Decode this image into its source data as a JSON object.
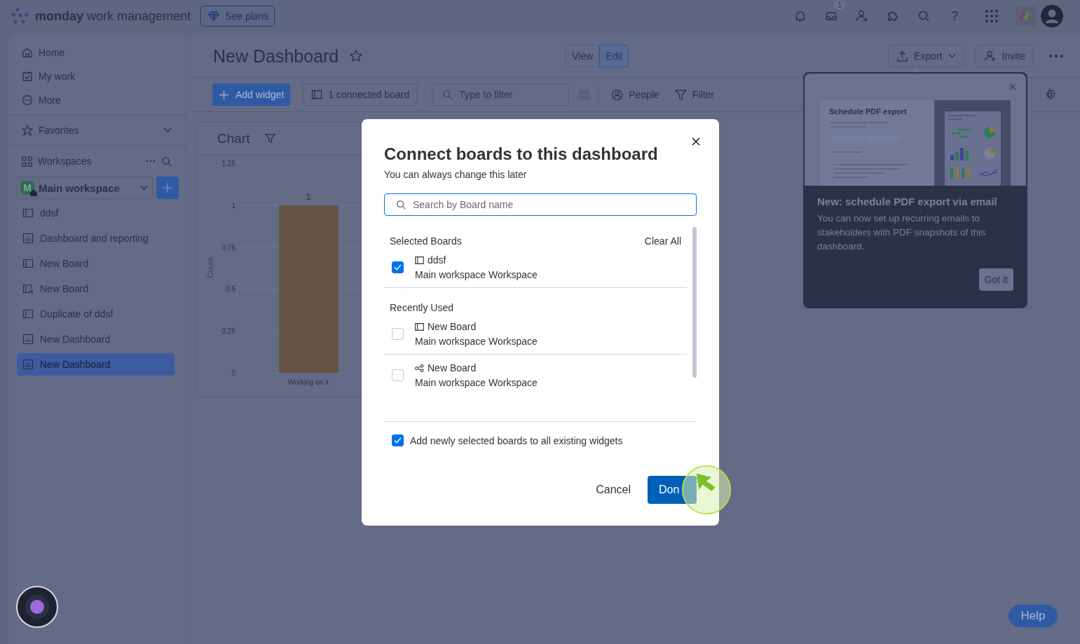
{
  "topbar": {
    "logo_bold": "monday",
    "logo_light": "work management",
    "plans_button": "See plans",
    "inbox_badge": "1",
    "help_glyph": "?"
  },
  "sidebar": {
    "nav": [
      {
        "label": "Home"
      },
      {
        "label": "My work"
      },
      {
        "label": "More"
      }
    ],
    "favorites": "Favorites",
    "workspaces": "Workspaces",
    "workspace": {
      "initial": "M",
      "name": "Main workspace"
    },
    "items": [
      {
        "label": "ddsf",
        "kind": "board",
        "selected": false
      },
      {
        "label": "Dashboard and reporting",
        "kind": "dashboard",
        "selected": false
      },
      {
        "label": "New Board",
        "kind": "board",
        "selected": false
      },
      {
        "label": "New Board",
        "kind": "shared",
        "selected": false
      },
      {
        "label": "Duplicate of ddsf",
        "kind": "board",
        "selected": false
      },
      {
        "label": "New Dashboard",
        "kind": "dashboard",
        "selected": false
      },
      {
        "label": "New Dashboard",
        "kind": "dashboard",
        "selected": true
      }
    ]
  },
  "dashboard": {
    "title": "New Dashboard",
    "view_toggle": [
      {
        "label": "View",
        "selected": false
      },
      {
        "label": "Edit",
        "selected": true
      }
    ],
    "export": "Export",
    "invite": "Invite",
    "toolbar": {
      "add_widget": "Add widget",
      "connected": "1 connected board",
      "filter_placeholder": "Type to filter",
      "people": "People",
      "filter": "Filter"
    }
  },
  "chart_widget": {
    "title": "Chart",
    "chart_data": {
      "type": "bar",
      "ylabel": "Count",
      "categories": [
        "Working on it"
      ],
      "values": [
        1
      ],
      "ylim": [
        0,
        1.25
      ],
      "yticks": [
        0,
        0.25,
        0.5,
        0.75,
        1,
        1.25
      ],
      "grid": true,
      "data_labels": true
    }
  },
  "popover": {
    "preview_title": "Schedule PDF export",
    "title": "New: schedule PDF export via email",
    "body": "You can now set up recurring emails to stakeholders with PDF snapshots of this dashboard.",
    "button": "Got it"
  },
  "modal": {
    "title": "Connect boards to this dashboard",
    "subtitle": "You can always change this later",
    "search": {
      "placeholder": "Search by Board name"
    },
    "sections": [
      {
        "title": "Selected Boards",
        "action": "Clear All",
        "boards": [
          {
            "name": "ddsf",
            "workspace": "Main workspace Workspace",
            "kind": "board",
            "checked": true
          }
        ]
      },
      {
        "title": "Recently Used",
        "boards": [
          {
            "name": "New Board",
            "workspace": "Main workspace Workspace",
            "kind": "board",
            "checked": false
          },
          {
            "name": "New Board",
            "workspace": "Main workspace Workspace",
            "kind": "shared",
            "checked": false
          }
        ]
      }
    ],
    "add_to_widgets": {
      "label": "Add newly selected boards to all existing widgets",
      "checked": true
    },
    "cancel": "Cancel",
    "done": "Don"
  },
  "help": "Help"
}
